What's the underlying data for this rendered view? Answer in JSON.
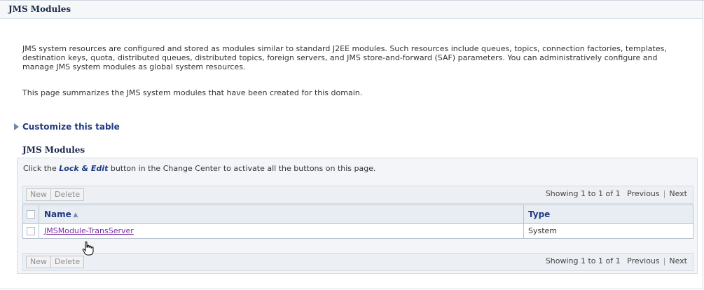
{
  "page": {
    "title": "JMS Modules"
  },
  "intro": {
    "paragraph1": "JMS system resources are configured and stored as modules similar to standard J2EE modules. Such resources include queues, topics, connection factories, templates, destination keys, quota, distributed queues, distributed topics, foreign servers, and JMS store-and-forward (SAF) parameters. You can administratively configure and manage JMS system modules as global system resources.",
    "paragraph2": "This page summarizes the JMS system modules that have been created for this domain."
  },
  "customize": {
    "label": "Customize this table"
  },
  "section": {
    "title": "JMS Modules"
  },
  "instruction": {
    "prefix": "Click the ",
    "lock_edit": "Lock & Edit",
    "suffix": " button in the Change Center to activate all the buttons on this page."
  },
  "toolbar": {
    "new_label": "New",
    "delete_label": "Delete",
    "showing": "Showing 1 to 1 of 1",
    "previous": "Previous",
    "separator": "|",
    "next": "Next"
  },
  "table": {
    "columns": [
      {
        "label": "Name",
        "sort": "⩓"
      },
      {
        "label": "Type"
      }
    ],
    "rows": [
      {
        "name": "JMSModule-TransServer",
        "type": "System"
      }
    ]
  },
  "icons": {
    "expand": "triangle-right-icon",
    "sort": "sort-ascending-icon",
    "cursor": "hand-pointer-icon"
  }
}
